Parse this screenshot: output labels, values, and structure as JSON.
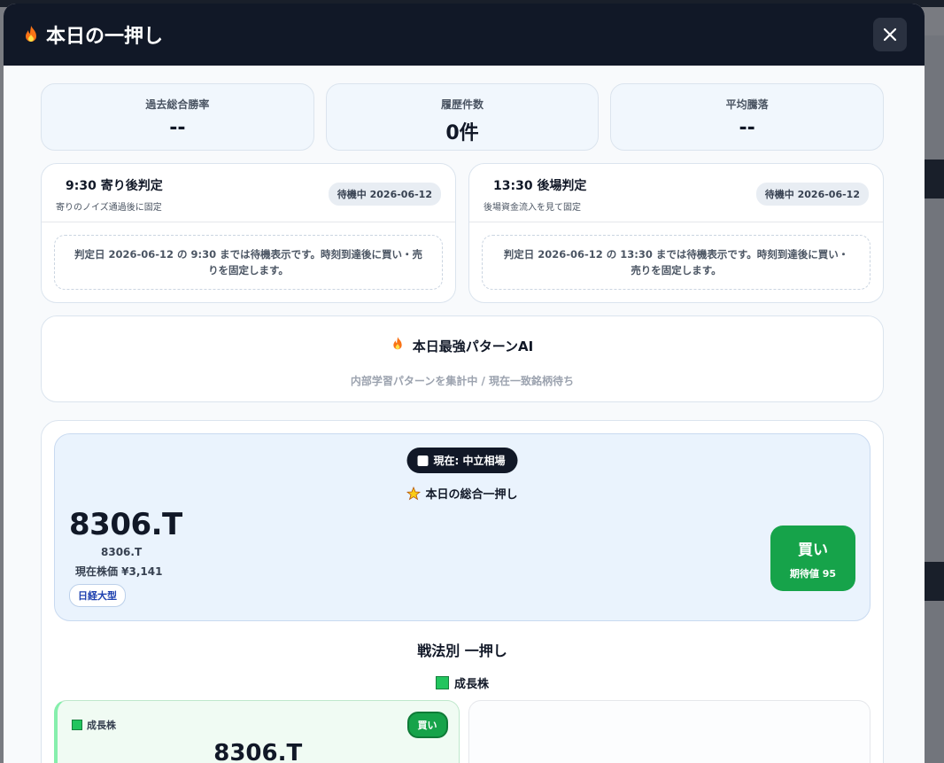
{
  "modal": {
    "title": "本日の一押し",
    "title_icon": "flame-icon",
    "close_icon": "close-icon"
  },
  "stats": [
    {
      "label": "過去総合勝率",
      "value": "--"
    },
    {
      "label": "履歴件数",
      "value": "0件"
    },
    {
      "label": "平均騰落",
      "value": "--"
    }
  ],
  "judgments": [
    {
      "title": "9:30 寄り後判定",
      "subtitle": "寄りのノイズ通過後に固定",
      "badge": "待機中 2026-06-12",
      "note": "判定日 2026-06-12 の 9:30 までは待機表示です。時刻到達後に買い・売りを固定します。"
    },
    {
      "title": "13:30 後場判定",
      "subtitle": "後場資金流入を見て固定",
      "badge": "待機中 2026-06-12",
      "note": "判定日 2026-06-12 の 13:30 までは待機表示です。時刻到達後に買い・売りを固定します。"
    }
  ],
  "ai": {
    "title": "本日最強パターンAI",
    "subtitle": "内部学習パターンを集計中 / 現在一致銘柄待ち"
  },
  "pick": {
    "market": "現在: 中立相場",
    "heading": "本日の総合一押し",
    "ticker": "8306.T",
    "ticker_sub": "8306.T",
    "price": "現在株価 ¥3,141",
    "tag": "日経大型",
    "action": "買い",
    "expectation": "期待値 95"
  },
  "strategy": {
    "title": "戦法別 一押し",
    "group_label": "成長株",
    "cards": [
      {
        "label": "成長株",
        "action": "買い",
        "ticker": "8306.T"
      }
    ]
  },
  "colors": {
    "header_bg": "#111827",
    "buy_green": "#16a34a",
    "pick_bg": "#eaf3fd"
  }
}
